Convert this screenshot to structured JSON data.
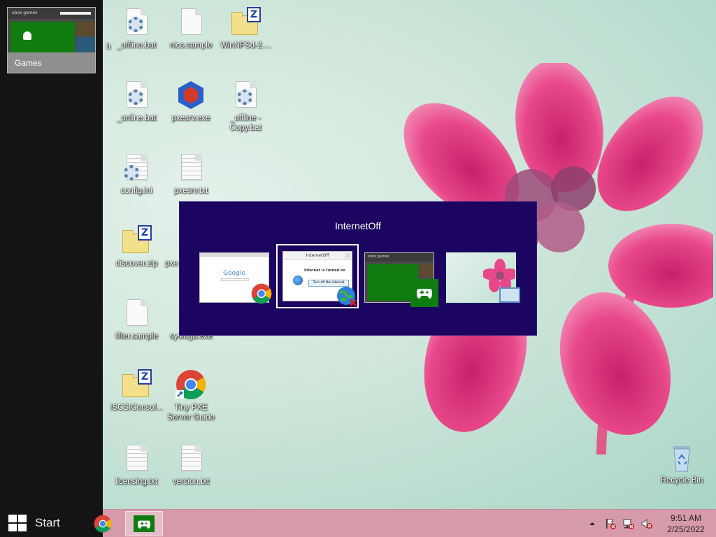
{
  "switch_list": {
    "thumbnail": {
      "label": "Games",
      "inner_title": "xbox games"
    }
  },
  "start": {
    "label": "Start"
  },
  "desktop_icons": [
    {
      "name": "_offline.bat"
    },
    {
      "name": "nics.sample"
    },
    {
      "name": "WinNFSd-2...."
    },
    {
      "name": "_online.bat"
    },
    {
      "name": "pxesrv.exe"
    },
    {
      "name": "_offline - Copy.bat"
    },
    {
      "name": "config.ini"
    },
    {
      "name": "pxesrv.txt"
    },
    {
      "name": "discover.zip"
    },
    {
      "name": "pxe"
    },
    {
      "name": "filter.sample"
    },
    {
      "name": "syslogd.exe"
    },
    {
      "name": "ISCSIConsol..."
    },
    {
      "name": "Tiny PXE Server Guide"
    },
    {
      "name": "licensing.txt"
    },
    {
      "name": "version.txt"
    },
    {
      "name": "Recycle Bin"
    },
    {
      "name": "h"
    }
  ],
  "switcher": {
    "title": "InternetOff",
    "items": [
      {
        "app": "Google Chrome",
        "page_text": "Google"
      },
      {
        "app": "InternetOff",
        "window_title": "InternetOff",
        "message": "Internet is turned on",
        "button": "Turn off the internet"
      },
      {
        "app": "Games",
        "window_title": "xbox games"
      },
      {
        "app": "Desktop"
      }
    ]
  },
  "tray": {
    "time": "9:51 AM",
    "date": "2/25/2022"
  },
  "colors": {
    "switcher_bg": "#1c0560",
    "taskbar_bg": "#d79aab",
    "xbox_green": "#107c10",
    "petal": "#e8488a"
  }
}
